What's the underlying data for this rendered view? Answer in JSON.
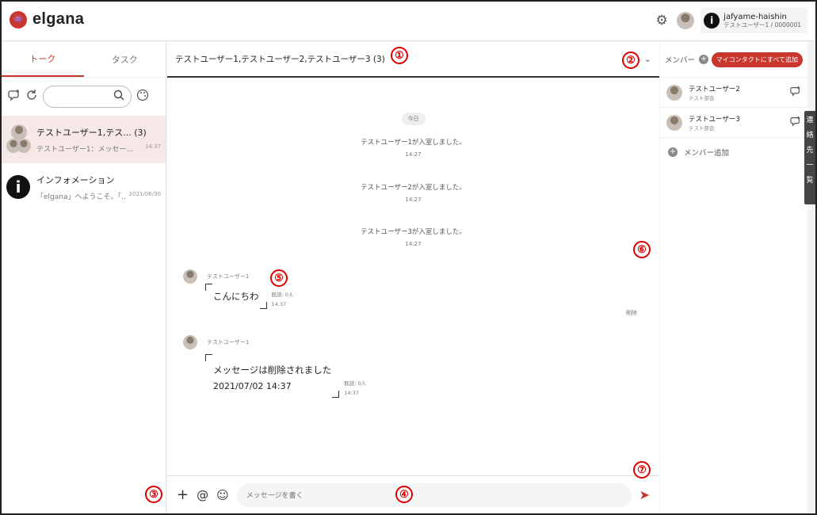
{
  "app": {
    "logo_mark": "👾",
    "name": "elgana"
  },
  "header": {
    "user_name": "jafyame-haishin",
    "user_sub": "テストユーザー1 / 0000001",
    "info_glyph": "i"
  },
  "left": {
    "tabs": [
      {
        "label": "トーク"
      },
      {
        "label": "タスク"
      }
    ],
    "search": {
      "placeholder": ""
    },
    "chats": [
      {
        "title": "テストユーザー1,テス...  (3)",
        "preview": "テストユーザー1：メッセー...",
        "time": "14:37"
      },
      {
        "title": "インフォメーション",
        "preview": "「elgana」へようこそ。「...",
        "time": "2021/06/30",
        "avatar_glyph": "i"
      }
    ]
  },
  "conversation": {
    "title": "テストユーザー1,テストユーザー2,テストユーザー3 (3)",
    "date_label": "今日",
    "system_events": [
      {
        "text": "テストユーザー1が入室しました。",
        "time": "14:27"
      },
      {
        "text": "テストユーザー2が入室しました。",
        "time": "14:27"
      },
      {
        "text": "テストユーザー3が入室しました。",
        "time": "14:27"
      }
    ],
    "messages": [
      {
        "sender": "テストユーザー1",
        "text": "こんにちわ",
        "read": "既読: 0人",
        "time": "14:37"
      },
      {
        "sender": "テストユーザー1",
        "text": "メッセージは削除されました",
        "sub": "2021/07/02 14:37",
        "read": "既読: 0人",
        "time": "14:37"
      }
    ],
    "delete_label": "削除",
    "composer": {
      "placeholder": "メッセージを書く"
    }
  },
  "right": {
    "members_label": "メンバー",
    "add_all_label": "マイコンタクトにすべて追加",
    "members": [
      {
        "name": "テストユーザー2",
        "dept": "テスト部会"
      },
      {
        "name": "テストユーザー3",
        "dept": "テスト部会"
      }
    ],
    "add_member_label": "メンバー追加",
    "contacts_tab_chars": [
      "連",
      "絡",
      "先",
      "一",
      "覧"
    ]
  },
  "callouts": [
    "①",
    "②",
    "③",
    "④",
    "⑤",
    "⑥",
    "⑦"
  ],
  "colors": {
    "accent": "#c9362e",
    "callout": "#dd0000"
  }
}
